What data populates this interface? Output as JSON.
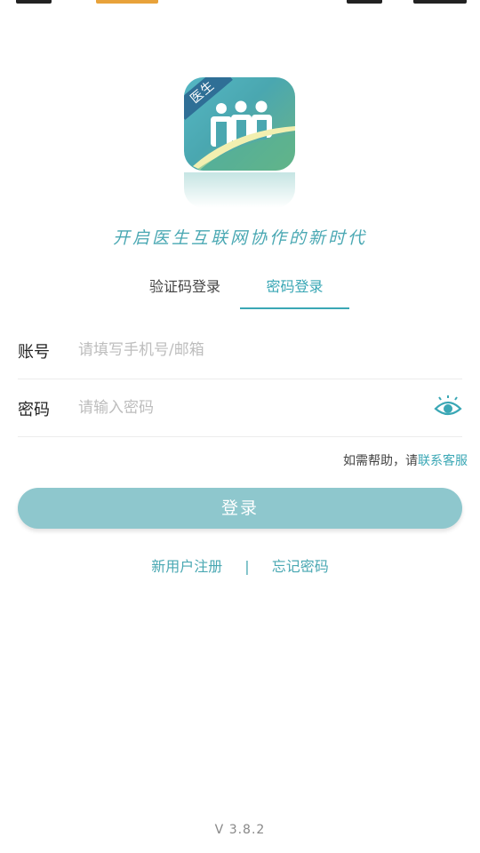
{
  "logo": {
    "tag_text": "医生",
    "accent": "#4aa7b0"
  },
  "slogan": "开启医生互联网协作的新时代",
  "tabs": [
    {
      "label": "验证码登录",
      "active": false
    },
    {
      "label": "密码登录",
      "active": true
    }
  ],
  "form": {
    "account": {
      "label": "账号",
      "placeholder": "请填写手机号/邮箱",
      "value": ""
    },
    "password": {
      "label": "密码",
      "placeholder": "请输入密码",
      "value": "",
      "toggle_icon": "eye-icon"
    }
  },
  "help": {
    "prefix": "如需帮助，请",
    "link": "联系客服"
  },
  "login_button": "登录",
  "links": {
    "register": "新用户注册",
    "separator": "|",
    "forgot": "忘记密码"
  },
  "version": "V 3.8.2",
  "colors": {
    "primary": "#3aa7b5",
    "button": "#8ec7cd"
  }
}
